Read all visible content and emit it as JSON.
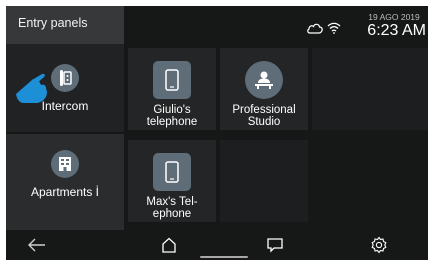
{
  "app": {
    "section_title": "Entry panels"
  },
  "status": {
    "date": "19 AGO 2019",
    "time": "6:23 AM",
    "cloud_icon": "cloud-icon",
    "wifi_icon": "wifi-icon"
  },
  "sidebar": {
    "items": [
      {
        "label": "Intercom",
        "icon": "intercom-phone-icon",
        "active": true
      },
      {
        "label": "Apartments İ",
        "icon": "apartment-building-icon",
        "active": false
      }
    ]
  },
  "grid": {
    "tiles": [
      {
        "label": "Giulio's\ntelephone",
        "icon": "smartphone-icon"
      },
      {
        "label": "Professional\nStudio",
        "icon": "professional-desk-icon"
      },
      {
        "label": "",
        "icon": ""
      },
      {
        "label": "Max's Tel-\nephone",
        "icon": "smartphone-icon"
      },
      {
        "label": "",
        "icon": ""
      }
    ]
  },
  "nav": {
    "back": "back-arrow-icon",
    "home": "home-icon",
    "messages": "message-icon",
    "settings": "gear-icon"
  },
  "colors": {
    "background": "#161818",
    "sidebar": "#2b2c2e",
    "tile": "#232526",
    "icon_fill": "#5e6d78",
    "pointer_hand": "#1d8fd6"
  }
}
